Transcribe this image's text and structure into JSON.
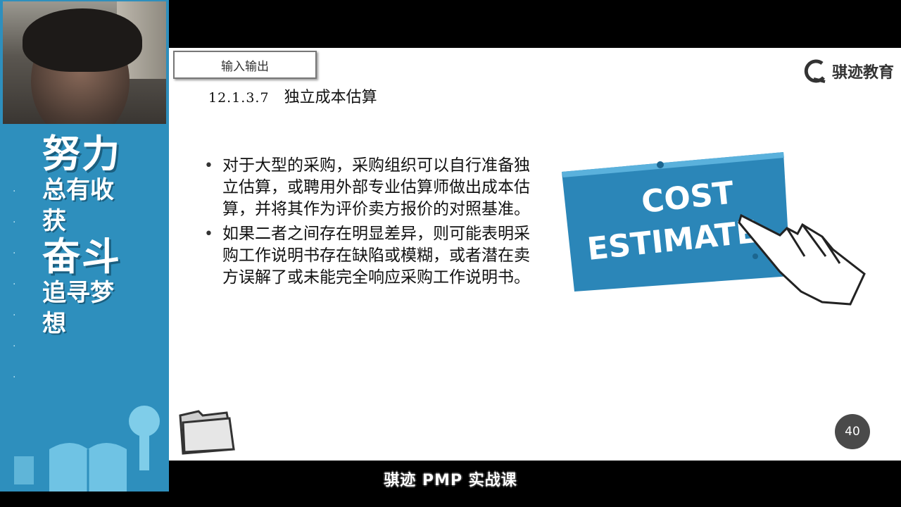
{
  "sidebar": {
    "line1": "努力",
    "line2": "总有收获",
    "line3": "奋斗",
    "line4": "追寻梦想"
  },
  "slide": {
    "tab_label": "输入输出",
    "logo_text": "骐迹教育",
    "section_number": "12.1.3.7",
    "section_title": "独立成本估算",
    "bullets": [
      "对于大型的采购，采购组织可以自行准备独立估算，或聘用外部专业估算师做出成本估算，并将其作为评价卖方报价的对照基准。",
      "如果二者之间存在明显差异，则可能表明采购工作说明书存在缺陷或模糊，或者潜在卖方误解了或未能完全响应采购工作说明书。"
    ],
    "sign_line1": "COST",
    "sign_line2": "ESTIMATE",
    "page_number": "40"
  },
  "caption": "骐迹 PMP 实战课",
  "colors": {
    "sidebar_blue": "#2e8fbd",
    "sign_blue": "#2b86b8"
  }
}
